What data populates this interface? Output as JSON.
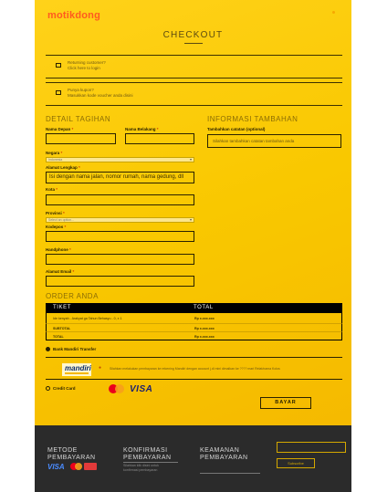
{
  "header": {
    "logo": "motikdong",
    "title": "CHECKOUT"
  },
  "notices": {
    "returning": {
      "line1": "Returning customer?",
      "line2": "Click here to login"
    },
    "coupon": {
      "line1": "Punya kupon?",
      "line2": "Masukkan kode voucher anda disini"
    }
  },
  "billing": {
    "heading": "DETAIL TAGIHAN",
    "first_name_label": "Nama Depan",
    "last_name_label": "Nama Belakang",
    "country_label": "Negara",
    "country_value": "Indonesia",
    "address_label": "Alamat Lengkap",
    "address_placeholder": "Isi dengan nama jalan, nomor rumah, nama gedung, dll",
    "city_label": "Kota",
    "province_label": "Provinsi",
    "province_value": "Select an option...",
    "postcode_label": "Kodepos",
    "phone_label": "Handphone",
    "email_label": "Alamat Email",
    "required_mark": "*"
  },
  "additional": {
    "heading": "INFORMASI TAMBAHAN",
    "notes_label": "Tambahkan catatan (optional)",
    "notes_placeholder": "Silahkan tambahkan catatan tambahan anda"
  },
  "order": {
    "heading": "ORDER ANDA",
    "columns": [
      "TIKET",
      "TOTAL"
    ],
    "rows": [
      {
        "label": "Ide kenyah - Arakyat ga Tahun Behasyu - 0, x 1",
        "value": "Rp x.xxx.xxx"
      },
      {
        "label": "SUBTOTAL",
        "value": "Rp x.xxx.xxx"
      },
      {
        "label": "TOTAL",
        "value": "Rp x.xxx.xxx"
      }
    ]
  },
  "payment": {
    "bank_label": "Bank Mandiri Transfer",
    "mandiri_name": "mandiri",
    "mandiri_note": "Silahkan melakukan pembayaran ke rekening Mandiri dengan account j.di mini dimalkan ke ???? mari Relat/nama Kolos",
    "card_label": "Credit Card",
    "card_brand": "VISA",
    "pay_button": "BAYAR"
  },
  "footer": {
    "col1": [
      "METODE",
      "PEMBAYARAN"
    ],
    "col2": [
      "KONFIRMASI",
      "PEMBAYARAN"
    ],
    "col2_sub": [
      "Silahkan klik disini untuk",
      "konfirmasi pembayaran"
    ],
    "col3": [
      "KEAMANAN",
      "PEMBAYARAN"
    ],
    "visa": "VISA",
    "subscribe_button": "Subscribe"
  },
  "colors": {
    "page_bg": "#f9c800",
    "footer_bg": "#2b2b2b",
    "accent": "#ff5a1f",
    "table_head": "#000000"
  },
  "icons": [
    "user-icon",
    "ticket-icon",
    "chevron-down-icon",
    "mastercard-logo",
    "visa-logo",
    "mandiri-logo",
    "bank-logo"
  ]
}
